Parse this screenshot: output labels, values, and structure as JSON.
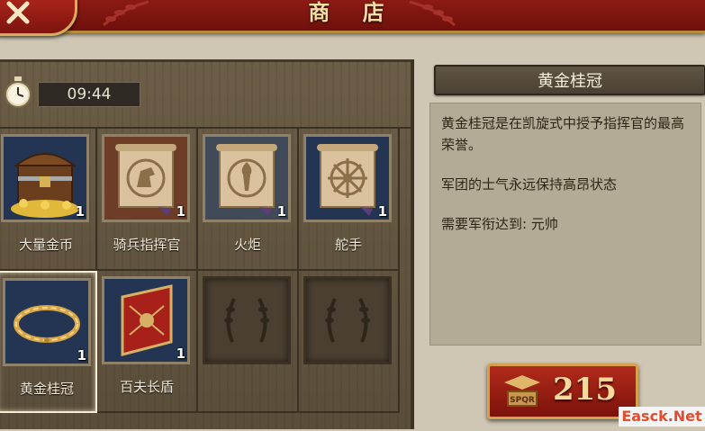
{
  "header": {
    "title": "商 店"
  },
  "timer": {
    "value": "09:44"
  },
  "items": [
    {
      "name": "大量金币",
      "qty": "1",
      "icon": "treasure-chest-icon"
    },
    {
      "name": "骑兵指挥官",
      "qty": "1",
      "icon": "cavalry-scroll-icon"
    },
    {
      "name": "火炬",
      "qty": "1",
      "icon": "torch-scroll-icon"
    },
    {
      "name": "舵手",
      "qty": "1",
      "icon": "helm-scroll-icon"
    },
    {
      "name": "黄金桂冠",
      "qty": "1",
      "icon": "golden-laurel-icon"
    },
    {
      "name": "百夫长盾",
      "qty": "1",
      "icon": "centurion-shield-icon"
    },
    {
      "name": "",
      "qty": "",
      "icon": "empty-slot-icon"
    },
    {
      "name": "",
      "qty": "",
      "icon": "empty-slot-icon"
    }
  ],
  "selected_index": 4,
  "detail": {
    "title": "黄金桂冠",
    "description": "黄金桂冠是在凯旋式中授予指挥官的最高荣誉。",
    "effect": "军团的士气永远保持高昂状态",
    "requirement": "需要军衔达到: 元帅"
  },
  "price": {
    "value": "215",
    "currency_icon": "spqr-emblem-icon"
  },
  "watermark": "Easck.Net",
  "colors": {
    "header_red": "#8d1a14",
    "gold": "#d3a14e",
    "wood": "#5a4d3a",
    "panel": "#b3ab96"
  }
}
